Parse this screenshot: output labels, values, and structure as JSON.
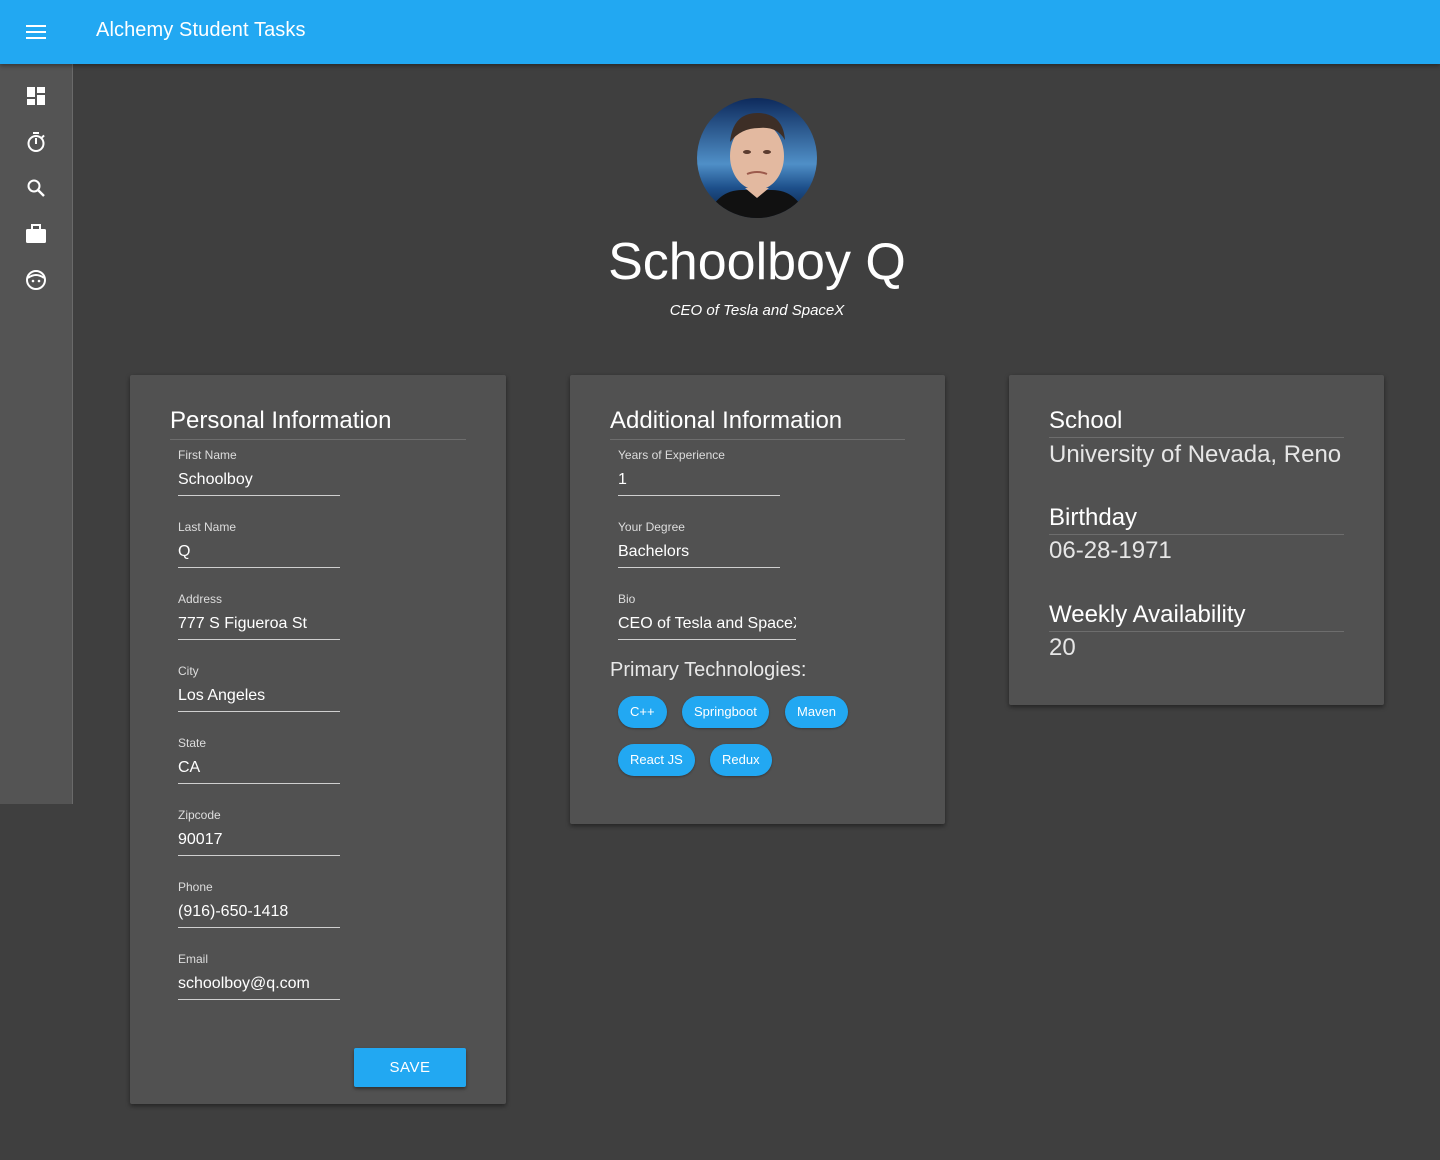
{
  "app": {
    "title": "Alchemy Student Tasks"
  },
  "sidebar": {
    "items": [
      {
        "icon": "dashboard-icon"
      },
      {
        "icon": "timer-icon"
      },
      {
        "icon": "search-icon"
      },
      {
        "icon": "briefcase-icon"
      },
      {
        "icon": "face-icon"
      }
    ]
  },
  "profile": {
    "name": "Schoolboy Q",
    "subtitle": "CEO of Tesla and SpaceX"
  },
  "personal": {
    "title": "Personal Information",
    "fields": [
      {
        "label": "First Name",
        "value": "Schoolboy"
      },
      {
        "label": "Last Name",
        "value": "Q"
      },
      {
        "label": "Address",
        "value": "777 S Figueroa St"
      },
      {
        "label": "City",
        "value": "Los Angeles"
      },
      {
        "label": "State",
        "value": "CA"
      },
      {
        "label": "Zipcode",
        "value": "90017"
      },
      {
        "label": "Phone",
        "value": "(916)-650-1418"
      },
      {
        "label": "Email",
        "value": "schoolboy@q.com"
      }
    ],
    "save_label": "SAVE"
  },
  "additional": {
    "title": "Additional Information",
    "fields": [
      {
        "label": "Years of Experience",
        "value": "1"
      },
      {
        "label": "Your Degree",
        "value": "Bachelors"
      },
      {
        "label": "Bio",
        "value": "CEO of Tesla and SpaceX"
      }
    ],
    "tech_heading": "Primary Technologies:",
    "technologies": [
      "C++",
      "Springboot",
      "Maven",
      "React JS",
      "Redux"
    ]
  },
  "info": {
    "school_label": "School",
    "school_value": "University of Nevada, Reno",
    "birthday_label": "Birthday",
    "birthday_value": "06-28-1971",
    "availability_label": "Weekly Availability",
    "availability_value": "20"
  },
  "colors": {
    "accent": "#22a8f2",
    "background": "#3f3f3f",
    "card": "#515151",
    "sidebar": "#545454"
  }
}
